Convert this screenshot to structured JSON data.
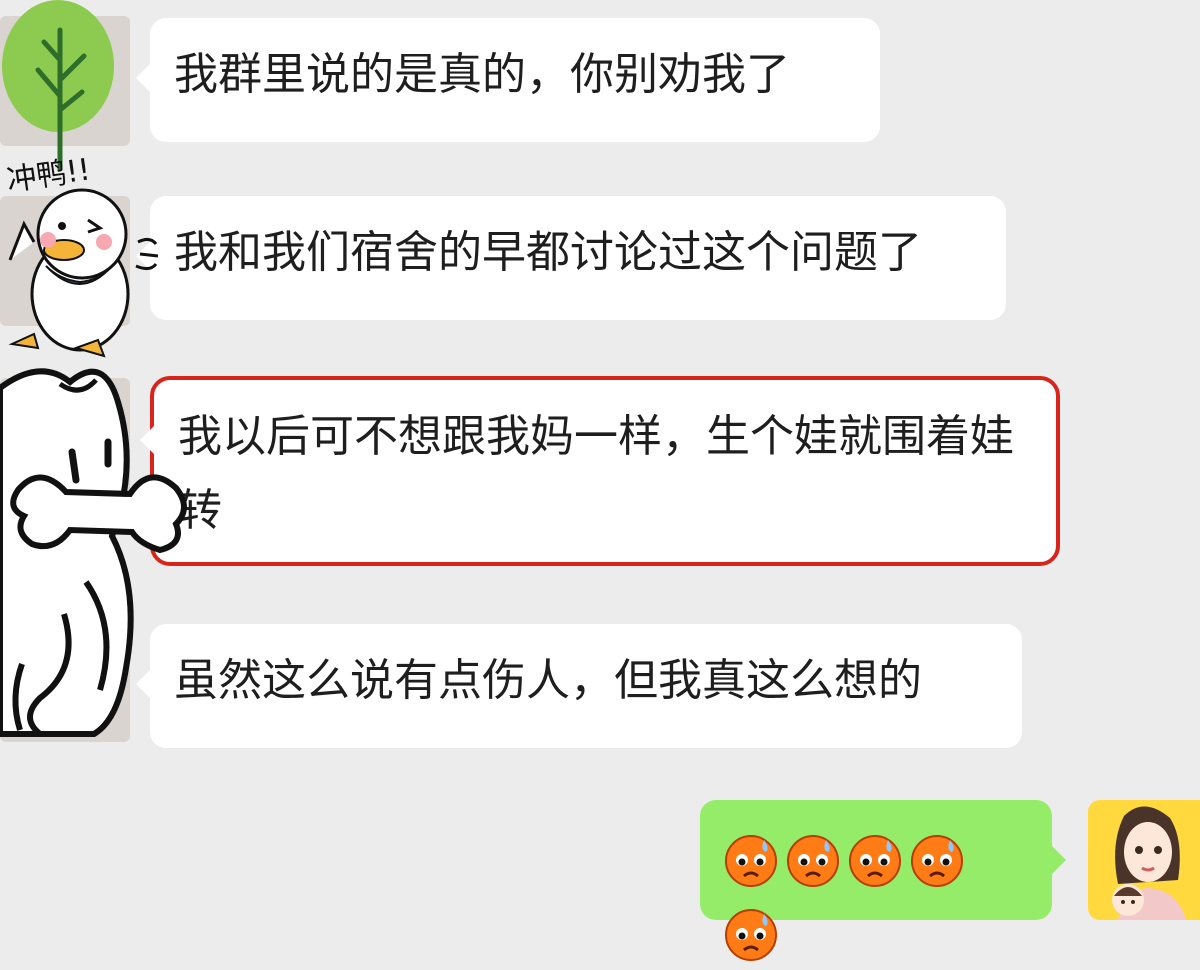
{
  "messages": [
    {
      "text": "我群里说的是真的，你别劝我了"
    },
    {
      "text": "我和我们宿舍的早都讨论过这个问题了"
    },
    {
      "text": "我以后可不想跟我妈一样，生个娃就围着娃转"
    },
    {
      "text": "虽然这么说有点伤人，但我真这么想的"
    }
  ],
  "reply": {
    "emoji_count": 5,
    "emoji_icon": "sweating-face-icon"
  },
  "sticker": {
    "duck_caption": "冲鸭!!"
  },
  "colors": {
    "background": "#ececec",
    "incoming_bubble": "#ffffff",
    "outgoing_bubble": "#95ec69",
    "highlight_border": "#d9241c"
  }
}
